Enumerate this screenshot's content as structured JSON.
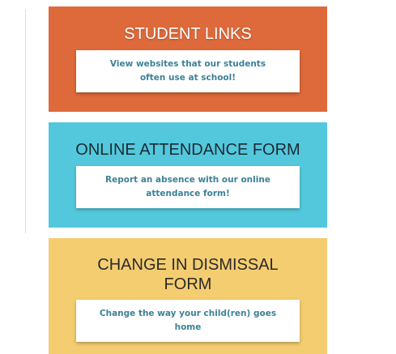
{
  "colors": {
    "card_1_background": "#de6a3b",
    "card_2_background": "#53c8dc",
    "card_3_background": "#f4cd70",
    "link_text": "#3d8197",
    "divider": "#dedede"
  },
  "cards": [
    {
      "title": "STUDENT LINKS",
      "link_text": "View websites that our students often use at school!"
    },
    {
      "title": "ONLINE ATTENDANCE FORM",
      "link_text": "Report an absence with our online attendance form!"
    },
    {
      "title": "CHANGE IN DISMISSAL FORM",
      "link_text": "Change the way your child(ren) goes home"
    }
  ]
}
